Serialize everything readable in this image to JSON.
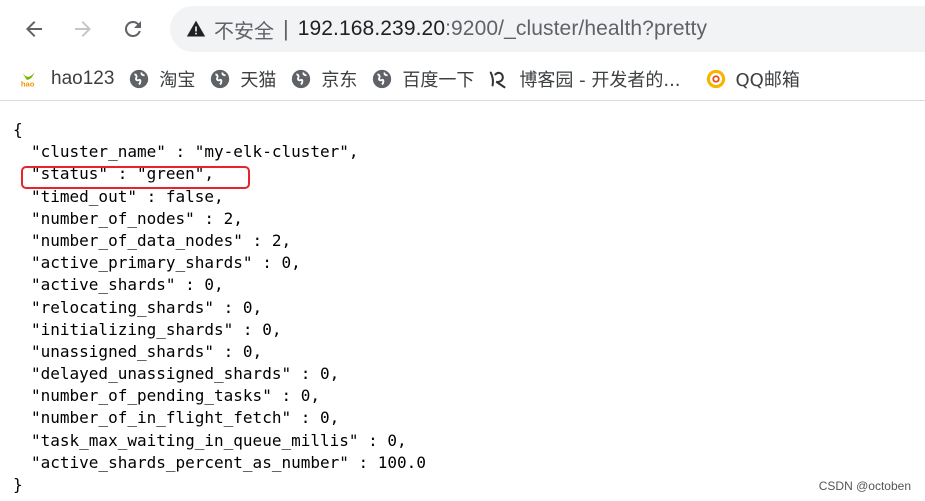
{
  "browser": {
    "security_label": "不安全",
    "separator": "|",
    "url_host": "192.168.239.20",
    "url_rest": ":9200/_cluster/health?pretty"
  },
  "bookmarks": [
    {
      "icon": "hao123-icon",
      "label": "hao123"
    },
    {
      "icon": "globe-icon",
      "label": "淘宝"
    },
    {
      "icon": "globe-icon",
      "label": "天猫"
    },
    {
      "icon": "globe-icon",
      "label": "京东"
    },
    {
      "icon": "globe-icon",
      "label": "百度一下"
    },
    {
      "icon": "cnblogs-icon",
      "label": "博客园 - 开发者的..."
    },
    {
      "icon": "qqmail-icon",
      "label": "QQ邮箱"
    }
  ],
  "json_text": {
    "open_brace": "{",
    "lines": [
      "\"cluster_name\" : \"my-elk-cluster\",",
      "\"status\" : \"green\",",
      "\"timed_out\" : false,",
      "\"number_of_nodes\" : 2,",
      "\"number_of_data_nodes\" : 2,",
      "\"active_primary_shards\" : 0,",
      "\"active_shards\" : 0,",
      "\"relocating_shards\" : 0,",
      "\"initializing_shards\" : 0,",
      "\"unassigned_shards\" : 0,",
      "\"delayed_unassigned_shards\" : 0,",
      "\"number_of_pending_tasks\" : 0,",
      "\"number_of_in_flight_fetch\" : 0,",
      "\"task_max_waiting_in_queue_millis\" : 0,",
      "\"active_shards_percent_as_number\" : 100.0"
    ],
    "close_brace": "}"
  },
  "colors": {
    "highlight_border": "#e8232b",
    "omnibox_bg": "#f1f3f4"
  },
  "watermark": "CSDN @octoben"
}
